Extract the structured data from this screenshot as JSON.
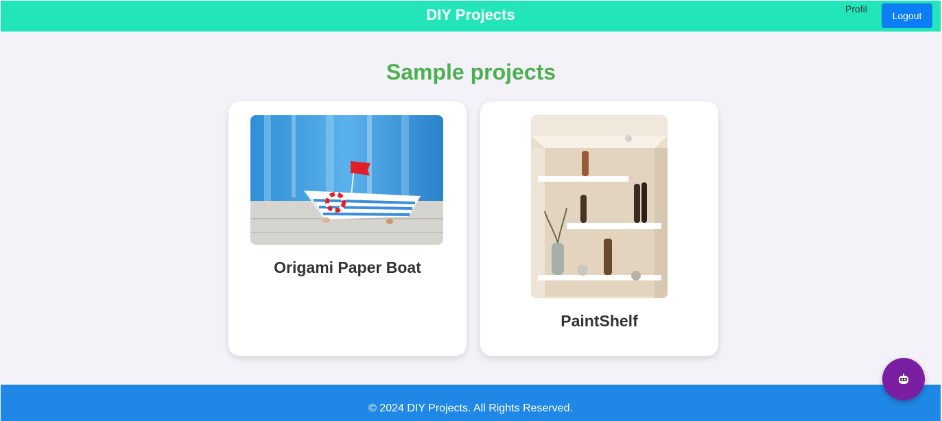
{
  "header": {
    "title": "DIY Projects",
    "profile_link": "Profil",
    "logout_label": "Logout"
  },
  "main": {
    "heading": "Sample projects",
    "projects": [
      {
        "title": "Origami Paper Boat",
        "image": "paper-boat-photo"
      },
      {
        "title": "PaintShelf",
        "image": "shelf-photo"
      }
    ]
  },
  "footer": {
    "copyright": "© 2024 DIY Projects. All Rights Reserved."
  },
  "chat_button": {
    "icon": "robot-icon"
  },
  "colors": {
    "header_bg": "#22e6b9",
    "logout_bg": "#0b7df5",
    "heading": "#4caf50",
    "footer_bg": "#1f87e5",
    "chat_bg": "#7b1fa2",
    "page_bg": "#f3f2f8"
  }
}
